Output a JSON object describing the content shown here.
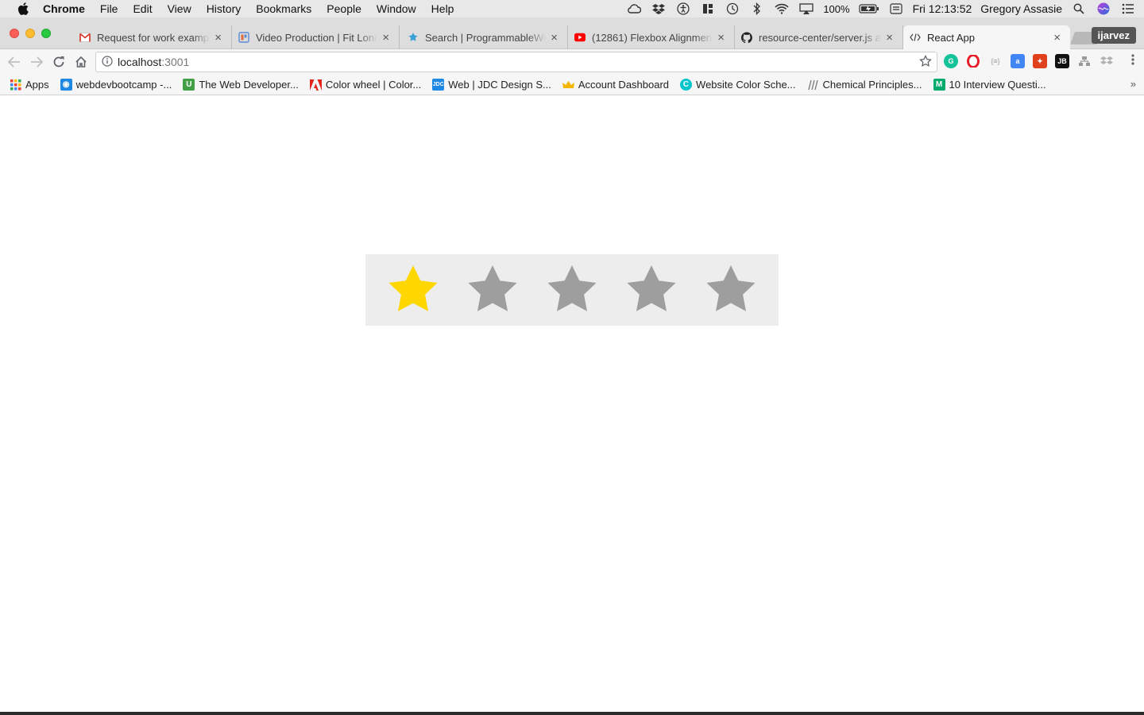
{
  "menubar": {
    "app": "Chrome",
    "items": [
      "File",
      "Edit",
      "View",
      "History",
      "Bookmarks",
      "People",
      "Window",
      "Help"
    ],
    "battery": "100%",
    "clock": "Fri 12:13:52",
    "user": "Gregory Assasie"
  },
  "tabs": [
    {
      "title": "Request for work examples",
      "icon": "gmail-icon",
      "color": "#d93025"
    },
    {
      "title": "Video Production | Fit London",
      "icon": "slides-icon",
      "color": "#4285f4"
    },
    {
      "title": "Search | ProgrammableWeb",
      "icon": "programmableweb-icon",
      "color": "#39a0d6"
    },
    {
      "title": "(12861) Flexbox Alignment",
      "icon": "youtube-icon",
      "color": "#ff0000"
    },
    {
      "title": "resource-center/server.js at",
      "icon": "github-icon",
      "color": "#222222"
    },
    {
      "title": "React App",
      "icon": "code-icon",
      "color": "#444444"
    }
  ],
  "profile": "ijarvez",
  "address": {
    "host": "localhost",
    "port": ":3001"
  },
  "bookmarks": [
    {
      "label": "Apps",
      "icon": "apps-grid-icon",
      "color": "#e8453c"
    },
    {
      "label": "webdevbootcamp -...",
      "icon": "webdevbootcamp-icon",
      "color": "#1e88e5"
    },
    {
      "label": "The Web Developer...",
      "icon": "udemy-icon",
      "color": "#43a047"
    },
    {
      "label": "Color wheel | Color...",
      "icon": "adobe-icon",
      "color": "#e1251b"
    },
    {
      "label": "Web | JDC Design S...",
      "icon": "jdc-icon",
      "color": "#1e88e5"
    },
    {
      "label": "Account Dashboard",
      "icon": "crown-icon",
      "color": "#f2b600"
    },
    {
      "label": "Website Color Sche...",
      "icon": "canva-icon",
      "color": "#00c4cc"
    },
    {
      "label": "Chemical Principles...",
      "icon": "chem-icon",
      "color": "#777777"
    },
    {
      "label": "10 Interview Questi...",
      "icon": "medium-icon",
      "color": "#00ab6c"
    }
  ],
  "rating": {
    "value": 1,
    "max": 5,
    "filled_color": "#ffd700",
    "empty_color": "#9e9e9e",
    "background": "#ededed"
  }
}
